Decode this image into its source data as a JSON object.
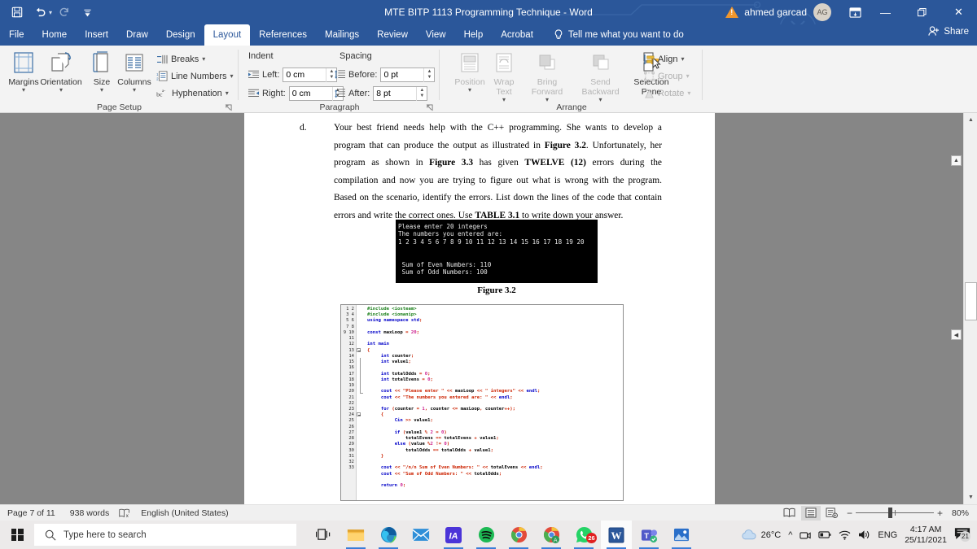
{
  "titlebar": {
    "document_title": "MTE BITP 1113 Programming Technique  -  Word",
    "quick_access": [
      {
        "name": "save",
        "glyph": "💾"
      },
      {
        "name": "undo",
        "glyph": "↶"
      },
      {
        "name": "redo",
        "glyph": "↻"
      },
      {
        "name": "customize-quick-access-toolbar",
        "glyph": "≡"
      }
    ],
    "user_name": "ahmed garcad",
    "user_initials": "AG",
    "ribbon_display_options": "⊞",
    "minimize": "—",
    "restore": "❐",
    "close": "✕",
    "accent_color": "#2b579a"
  },
  "tabs": [
    {
      "label": "File",
      "active": false
    },
    {
      "label": "Home",
      "active": false
    },
    {
      "label": "Insert",
      "active": false
    },
    {
      "label": "Draw",
      "active": false
    },
    {
      "label": "Design",
      "active": false
    },
    {
      "label": "Layout",
      "active": true
    },
    {
      "label": "References",
      "active": false
    },
    {
      "label": "Mailings",
      "active": false
    },
    {
      "label": "Review",
      "active": false
    },
    {
      "label": "View",
      "active": false
    },
    {
      "label": "Help",
      "active": false
    },
    {
      "label": "Acrobat",
      "active": false
    }
  ],
  "tell_me": "Tell me what you want to do",
  "share_label": "Share",
  "ribbon": {
    "groups": [
      {
        "name": "page-setup",
        "label": "Page Setup"
      },
      {
        "name": "paragraph",
        "label": "Paragraph"
      },
      {
        "name": "arrange",
        "label": "Arrange"
      }
    ],
    "page_setup": {
      "buttons": [
        {
          "label": "Margins",
          "name": "margins"
        },
        {
          "label": "Orientation",
          "name": "orientation"
        },
        {
          "label": "Size",
          "name": "size"
        },
        {
          "label": "Columns",
          "name": "columns"
        }
      ],
      "small_buttons": [
        {
          "label": "Breaks",
          "name": "breaks"
        },
        {
          "label": "Line Numbers",
          "name": "line-numbers"
        },
        {
          "label": "Hyphenation",
          "name": "hyphenation"
        }
      ]
    },
    "paragraph": {
      "indent_header": "Indent",
      "spacing_header": "Spacing",
      "indent_left_label": "Left:",
      "indent_left_value": "0 cm",
      "indent_right_label": "Right:",
      "indent_right_value": "0 cm",
      "spacing_before_label": "Before:",
      "spacing_before_value": "0 pt",
      "spacing_after_label": "After:",
      "spacing_after_value": "8 pt"
    },
    "arrange": {
      "buttons": [
        {
          "label": "Position",
          "name": "position",
          "disabled": true
        },
        {
          "label": "Wrap Text",
          "name": "wrap-text",
          "disabled": true
        },
        {
          "label": "Bring Forward",
          "name": "bring-forward",
          "disabled": true
        },
        {
          "label": "Send Backward",
          "name": "send-backward",
          "disabled": true
        },
        {
          "label": "Selection Pane",
          "name": "selection-pane",
          "disabled": false
        }
      ],
      "small_buttons": [
        {
          "label": "Align",
          "name": "align",
          "disabled": false
        },
        {
          "label": "Group",
          "name": "group",
          "disabled": true
        },
        {
          "label": "Rotate",
          "name": "rotate",
          "disabled": true
        }
      ]
    }
  },
  "document": {
    "item_label": "d.",
    "paragraph_part1": "Your best friend needs help with the C++ programming. She wants to develop a program that can produce the output as illustrated in ",
    "figure_ref_1": "Figure 3.2",
    "paragraph_part2": ". Unfortunately, her program as shown in ",
    "figure_ref_2": "Figure 3.3",
    "paragraph_part3": " has given ",
    "bold_twelve": "TWELVE (12)",
    "paragraph_part4": " errors during the compilation and now you are trying to figure out what is wrong with the program. Based on the scenario, identify the errors.  List down the lines of the code that contain errors and write the correct ones. Use ",
    "bold_table": "TABLE 3.1",
    "paragraph_part5": " to write down your answer.",
    "console_output": "Please enter 20 integers\nThe numbers you entered are:\n1 2 3 4 5 6 7 8 9 10 11 12 13 14 15 16 17 18 19 20\n\n\n Sum of Even Numbers: 110\n Sum of Odd Numbers: 100",
    "figure_caption": "Figure 3.2",
    "code_lines": [
      {
        "n": 1,
        "text": "#include <iosteam>"
      },
      {
        "n": 2,
        "text": "#include <iomanip>"
      },
      {
        "n": 3,
        "text": "using namespace std;"
      },
      {
        "n": 4,
        "text": ""
      },
      {
        "n": 5,
        "text": "const maxLoop = 20;"
      },
      {
        "n": 6,
        "text": ""
      },
      {
        "n": 7,
        "text": "int main"
      },
      {
        "n": 8,
        "text": "{"
      },
      {
        "n": 9,
        "text": "     int counter;"
      },
      {
        "n": 10,
        "text": "     int value1;"
      },
      {
        "n": 11,
        "text": ""
      },
      {
        "n": 12,
        "text": "     int totalOdds = 0;"
      },
      {
        "n": 13,
        "text": "     int totalEvens = 0;"
      },
      {
        "n": 14,
        "text": ""
      },
      {
        "n": 15,
        "text": "     cout << \"Please enter \" << maxLoop << \" integers\" << endl;"
      },
      {
        "n": 16,
        "text": "     cout << \"The numbers you entered are: \" << endl;"
      },
      {
        "n": 17,
        "text": ""
      },
      {
        "n": 18,
        "text": "     for (counter = 1, counter <= maxLoop, counter++);"
      },
      {
        "n": 19,
        "text": "     {"
      },
      {
        "n": 20,
        "text": "          Cin >> value1;"
      },
      {
        "n": 21,
        "text": ""
      },
      {
        "n": 22,
        "text": "          if (value1 % 2 = 0)"
      },
      {
        "n": 23,
        "text": "              totalEvens == totalEvens + value1;"
      },
      {
        "n": 24,
        "text": "          else (value %2 != 0)"
      },
      {
        "n": 25,
        "text": "              totalOdds == totalOdds + value1;"
      },
      {
        "n": 26,
        "text": "     }"
      },
      {
        "n": 27,
        "text": ""
      },
      {
        "n": 28,
        "text": "     cout << \"/n/n Sum of Even Numbers: \" << totalEvens << endl;"
      },
      {
        "n": 29,
        "text": "     cout << \"Sum of Odd Numbers: \" << totalOdds;"
      },
      {
        "n": 30,
        "text": ""
      },
      {
        "n": 31,
        "text": "     return 0;"
      },
      {
        "n": 32,
        "text": ""
      },
      {
        "n": 33,
        "text": ""
      }
    ]
  },
  "statusbar": {
    "page_indicator": "Page 7 of 11",
    "word_count": "938 words",
    "proofing_icon": "proofing-errors-icon",
    "language": "English (United States)",
    "views": [
      {
        "name": "read-mode",
        "glyph": "📖",
        "active": false
      },
      {
        "name": "print-layout",
        "glyph": "☰",
        "active": true
      },
      {
        "name": "web-layout",
        "glyph": "🗔",
        "active": false
      }
    ],
    "zoom_out": "−",
    "zoom_in": "+",
    "zoom_level": "80%"
  },
  "taskbar": {
    "search_placeholder": "Type here to search",
    "apps": [
      {
        "name": "task-view",
        "label": "Task View"
      },
      {
        "name": "file-explorer",
        "label": "File Explorer"
      },
      {
        "name": "microsoft-edge",
        "label": "Microsoft Edge"
      },
      {
        "name": "mail",
        "label": "Mail"
      },
      {
        "name": "app-violet",
        "label": "IA"
      },
      {
        "name": "spotify",
        "label": "Spotify"
      },
      {
        "name": "chrome-profile-1",
        "label": "Google Chrome"
      },
      {
        "name": "chrome-profile-2",
        "label": "Google Chrome"
      },
      {
        "name": "whatsapp",
        "label": "WhatsApp",
        "badge": "26"
      },
      {
        "name": "microsoft-word",
        "label": "Word",
        "active": true
      },
      {
        "name": "microsoft-teams",
        "label": "Microsoft Teams"
      },
      {
        "name": "photos",
        "label": "Photos"
      }
    ],
    "weather_temp": "26°C",
    "tray_icons": [
      "show-hidden-icons",
      "camera-icon",
      "battery-icon",
      "wifi-icon",
      "volume-icon"
    ],
    "language": "ENG",
    "clock_time": "4:17 AM",
    "clock_date": "25/11/2021",
    "notification_count": "21"
  }
}
